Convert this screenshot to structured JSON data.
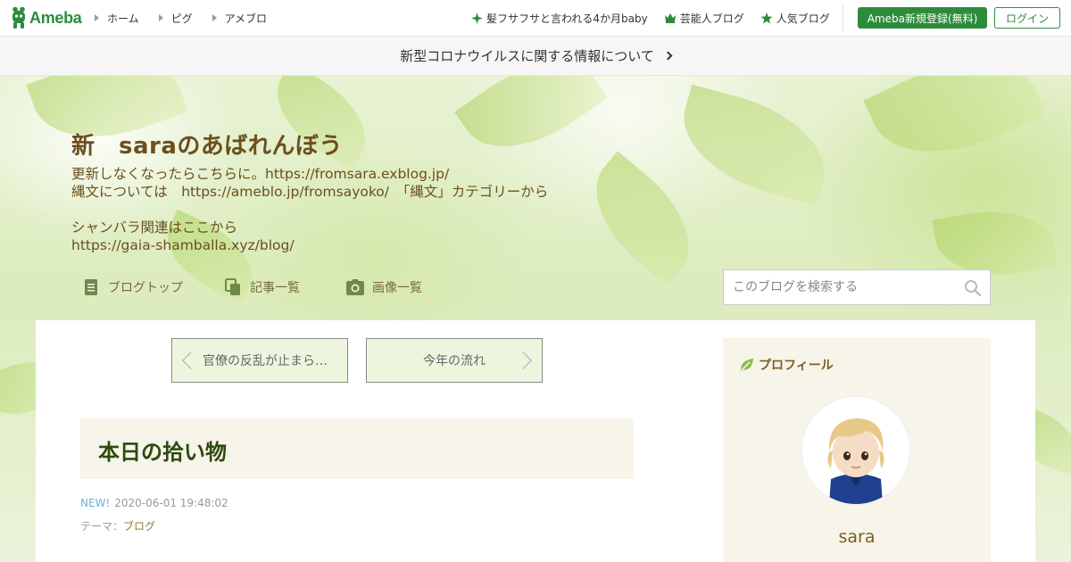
{
  "topbar": {
    "logo_text": "Ameba",
    "nav": [
      {
        "label": "ホーム"
      },
      {
        "label": "ピグ"
      },
      {
        "label": "アメブロ"
      }
    ],
    "links": [
      {
        "label": "髪フサフサと言われる4か月baby",
        "icon": "sparkle-icon"
      },
      {
        "label": "芸能人ブログ",
        "icon": "crown-icon"
      },
      {
        "label": "人気ブログ",
        "icon": "star-icon"
      }
    ],
    "register_label": "Ameba新規登録(無料)",
    "login_label": "ログイン",
    "accent": "#2d8c3c"
  },
  "notice": {
    "text": "新型コロナウイルスに関する情報について"
  },
  "blog": {
    "title": "新　saraのあばれんぼう",
    "description_lines": [
      "更新しなくなったらこちらに。https://fromsara.exblog.jp/",
      "縄文については　https://ameblo.jp/fromsayoko/　「縄文」カテゴリーから",
      "",
      "シャンバラ関連はここから",
      "https://gaia-shamballa.xyz/blog/"
    ],
    "title_color": "#6b4f1d"
  },
  "blog_nav": [
    {
      "label": "ブログトップ",
      "icon": "document-icon"
    },
    {
      "label": "記事一覧",
      "icon": "copy-icon"
    },
    {
      "label": "画像一覧",
      "icon": "camera-icon"
    }
  ],
  "search": {
    "placeholder": "このブログを検索する"
  },
  "pager": {
    "prev_label": "官僚の反乱が止まら…",
    "next_label": "今年の流れ"
  },
  "entry": {
    "title": "本日の拾い物",
    "new_label": "NEW!",
    "datetime": "2020-06-01 19:48:02",
    "theme_prefix": "テーマ：",
    "theme": "ブログ"
  },
  "profile": {
    "heading": "プロフィール",
    "name": "sara"
  }
}
